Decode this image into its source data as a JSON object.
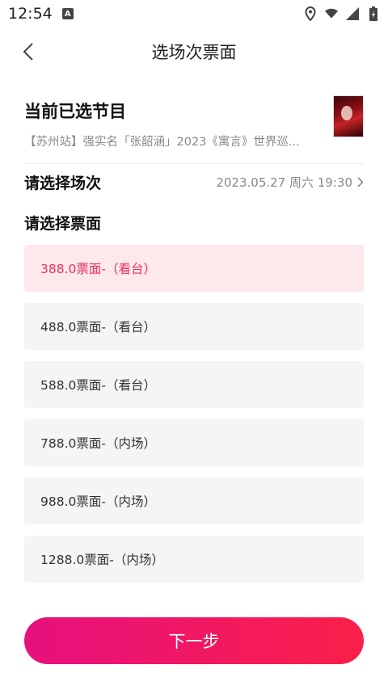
{
  "status": {
    "time": "12:54",
    "badge": "A"
  },
  "nav": {
    "title": "选场次票面"
  },
  "selected_show": {
    "heading": "当前已选节目",
    "name": "【苏州站】强实名「张韶涵」2023《寓言》世界巡..."
  },
  "session": {
    "label": "请选择场次",
    "value": "2023.05.27 周六 19:30"
  },
  "tickets": {
    "heading": "请选择票面",
    "items": [
      {
        "label": "388.0票面-（看台）"
      },
      {
        "label": "488.0票面-（看台）"
      },
      {
        "label": "588.0票面-（看台）"
      },
      {
        "label": "788.0票面-（内场）"
      },
      {
        "label": "988.0票面-（内场）"
      },
      {
        "label": "1288.0票面-（内场）"
      }
    ]
  },
  "footer": {
    "next_label": "下一步"
  },
  "colors": {
    "accent": "#e8315a",
    "selected_bg": "#fde8ec",
    "button_start": "#e6107e",
    "button_end": "#fb1f49"
  }
}
